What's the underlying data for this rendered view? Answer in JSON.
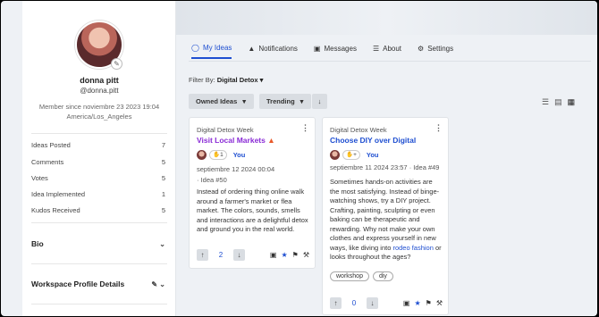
{
  "profile": {
    "name": "donna pitt",
    "handle": "@donna.pitt",
    "member_since": "Member since noviembre 23 2023 19:04",
    "timezone": "America/Los_Angeles"
  },
  "stats": [
    {
      "label": "Ideas Posted",
      "value": "7"
    },
    {
      "label": "Comments",
      "value": "5"
    },
    {
      "label": "Votes",
      "value": "5"
    },
    {
      "label": "Idea Implemented",
      "value": "1"
    },
    {
      "label": "Kudos Received",
      "value": "5"
    }
  ],
  "sections": {
    "bio": "Bio",
    "workspace": "Workspace Profile Details"
  },
  "tabs": [
    "My Ideas",
    "Notifications",
    "Messages",
    "About",
    "Settings"
  ],
  "filter": {
    "label": "Filter By:",
    "value": "Digital Detox"
  },
  "controls": {
    "owned": "Owned Ideas",
    "trending": "Trending"
  },
  "cards": [
    {
      "category": "Digital Detox Week",
      "title": "Visit Local Markets",
      "title_color": "#8a2bd6",
      "reaction_count": "1",
      "author": "You",
      "date": "septiembre 12 2024 00:04",
      "idea_no": "· Idea #50",
      "body": "Instead of ordering thing online walk around a farmer's market or flea market. The colors, sounds, smells and interactions are a delightful detox and ground you in the real world.",
      "votes": "2"
    },
    {
      "category": "Digital Detox Week",
      "title": "Choose DIY over Digital",
      "title_color": "#1f4fd1",
      "reaction_count": "+",
      "author": "You",
      "date": "septiembre 11 2024 23:57",
      "idea_no": "· Idea #49",
      "body_pre": "Sometimes hands-on activities are the most satisfying. Instead of binge-watching shows, try a DIY project. Crafting, painting, sculpting or even baking can be therapeutic and rewarding. Why not make your own clothes and express yourself in new ways, like diving into ",
      "body_link": "rodeo fashion",
      "body_post": " or looks throughout the ages?",
      "tags": [
        "workshop",
        "diy"
      ],
      "votes": "0"
    }
  ]
}
